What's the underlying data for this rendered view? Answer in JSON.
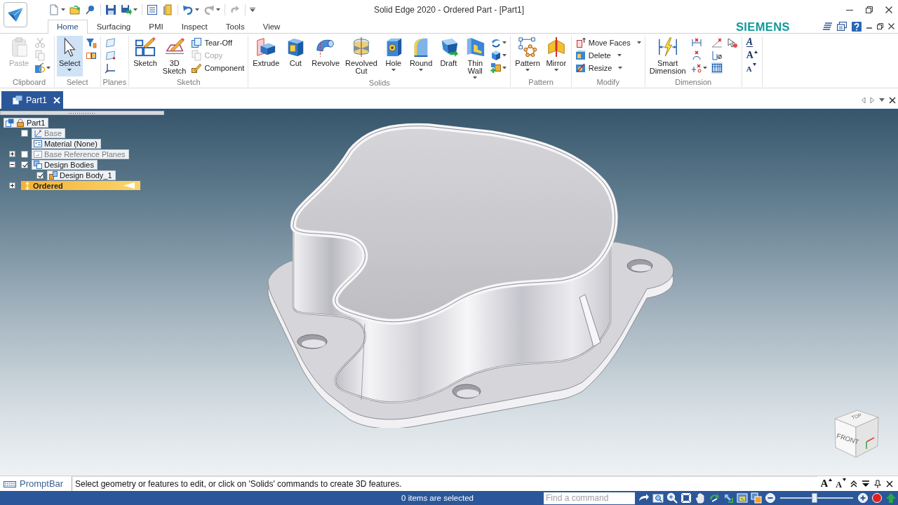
{
  "window": {
    "title": "Solid Edge 2020 - Ordered Part - [Part1]"
  },
  "quick_access": [
    {
      "items": [
        {
          "dropdown": true,
          "disabled": false
        },
        {
          "dropdown": false,
          "disabled": false
        },
        {
          "dropdown": false,
          "disabled": false
        }
      ]
    },
    {
      "items": [
        {
          "dropdown": false,
          "disabled": false
        },
        {
          "dropdown": true,
          "disabled": false
        }
      ]
    },
    {
      "items": [
        {
          "dropdown": false,
          "disabled": false
        },
        {
          "dropdown": false,
          "disabled": false
        }
      ]
    },
    {
      "items": [
        {
          "dropdown": true,
          "disabled": false
        },
        {
          "dropdown": true,
          "disabled": true
        }
      ]
    },
    {
      "items": [
        {
          "dropdown": false,
          "disabled": true
        }
      ]
    }
  ],
  "tabs": [
    {
      "label": "Home",
      "selected": true
    },
    {
      "label": "Surfacing",
      "selected": false
    },
    {
      "label": "PMI",
      "selected": false
    },
    {
      "label": "Inspect",
      "selected": false
    },
    {
      "label": "Tools",
      "selected": false
    },
    {
      "label": "View",
      "selected": false
    }
  ],
  "brand": "SIEMENS",
  "ribbon": {
    "groups": [
      {
        "label": "Clipboard",
        "items": [
          {
            "kind": "large",
            "label": "Paste",
            "disabled": true,
            "active": false,
            "dropdown": false
          },
          {
            "kind": "icon",
            "disabled": true,
            "active": false,
            "dropdown": false
          },
          {
            "kind": "icon",
            "disabled": true,
            "active": false,
            "dropdown": false
          },
          {
            "kind": "icon",
            "disabled": false,
            "active": false,
            "dropdown": true
          }
        ]
      },
      {
        "label": "Select",
        "items": [
          {
            "kind": "large",
            "label": "Select",
            "disabled": false,
            "active": true,
            "dropdown": true
          },
          {
            "kind": "icon",
            "disabled": false,
            "active": false,
            "dropdown": false
          },
          {
            "kind": "icon",
            "disabled": false,
            "active": false,
            "dropdown": false
          }
        ]
      },
      {
        "label": "Planes",
        "items": [
          {
            "kind": "icon",
            "disabled": false,
            "active": false,
            "dropdown": false
          },
          {
            "kind": "icon",
            "disabled": false,
            "active": false,
            "dropdown": false
          },
          {
            "kind": "icon",
            "disabled": false,
            "active": false,
            "dropdown": false
          }
        ]
      },
      {
        "label": "Sketch",
        "items": [
          {
            "kind": "large",
            "label": "Sketch",
            "disabled": false,
            "active": false,
            "dropdown": false
          },
          {
            "kind": "large",
            "label": "3D Sketch",
            "disabled": false,
            "active": false,
            "dropdown": false
          },
          {
            "kind": "small",
            "label": "Tear-Off",
            "disabled": false,
            "active": false,
            "dropdown": false
          },
          {
            "kind": "small",
            "label": "Copy",
            "disabled": true,
            "active": false,
            "dropdown": false
          },
          {
            "kind": "small",
            "label": "Component",
            "disabled": false,
            "active": false,
            "dropdown": false
          }
        ]
      },
      {
        "label": "Solids",
        "items": [
          {
            "kind": "large",
            "label": "Extrude",
            "disabled": false,
            "active": false,
            "dropdown": false
          },
          {
            "kind": "large",
            "label": "Cut",
            "disabled": false,
            "active": false,
            "dropdown": false
          },
          {
            "kind": "large",
            "label": "Revolve",
            "disabled": false,
            "active": false,
            "dropdown": false
          },
          {
            "kind": "large",
            "label": "Revolved Cut",
            "disabled": false,
            "active": false,
            "dropdown": false
          },
          {
            "kind": "large",
            "label": "Hole",
            "disabled": false,
            "active": false,
            "dropdown": true
          },
          {
            "kind": "large",
            "label": "Round",
            "disabled": false,
            "active": false,
            "dropdown": true
          },
          {
            "kind": "large",
            "label": "Draft",
            "disabled": false,
            "active": false,
            "dropdown": false
          },
          {
            "kind": "large",
            "label": "Thin Wall",
            "disabled": false,
            "active": false,
            "dropdown": true
          },
          {
            "kind": "icon",
            "disabled": false,
            "active": false,
            "dropdown": true
          },
          {
            "kind": "icon",
            "disabled": false,
            "active": false,
            "dropdown": true
          },
          {
            "kind": "icon",
            "disabled": false,
            "active": false,
            "dropdown": true
          }
        ]
      },
      {
        "label": "Pattern",
        "items": [
          {
            "kind": "large",
            "label": "Pattern",
            "disabled": false,
            "active": false,
            "dropdown": true
          },
          {
            "kind": "large",
            "label": "Mirror",
            "disabled": false,
            "active": false,
            "dropdown": true
          }
        ]
      },
      {
        "label": "Modify",
        "items": [
          {
            "kind": "small",
            "label": "Move Faces",
            "disabled": false,
            "active": false,
            "dropdown": true
          },
          {
            "kind": "small",
            "label": "Delete",
            "disabled": false,
            "active": false,
            "dropdown": true
          },
          {
            "kind": "small",
            "label": "Resize",
            "disabled": false,
            "active": false,
            "dropdown": true
          }
        ]
      },
      {
        "label": "Dimension",
        "items": [
          {
            "kind": "large",
            "label": "Smart Dimension",
            "disabled": false,
            "active": false,
            "dropdown": false
          },
          {
            "kind": "icon",
            "disabled": false,
            "active": false,
            "dropdown": false
          },
          {
            "kind": "icon",
            "disabled": false,
            "active": false,
            "dropdown": false
          },
          {
            "kind": "icon",
            "disabled": false,
            "active": false,
            "dropdown": true
          },
          {
            "kind": "icon",
            "disabled": false,
            "active": false,
            "dropdown": false
          },
          {
            "kind": "icon",
            "disabled": false,
            "active": false,
            "dropdown": false
          },
          {
            "kind": "icon",
            "disabled": false,
            "active": true,
            "dropdown": false
          },
          {
            "kind": "icon",
            "disabled": false,
            "active": false,
            "dropdown": false
          }
        ]
      },
      {
        "items": [
          {
            "kind": "style",
            "label": "A",
            "disabled": false,
            "active": false,
            "dropdown": false
          },
          {
            "kind": "grow",
            "label": "A",
            "disabled": false,
            "active": false,
            "dropdown": false
          },
          {
            "kind": "shrink",
            "label": "A",
            "disabled": false,
            "active": false,
            "dropdown": false
          }
        ]
      }
    ]
  },
  "document_tabs": [
    {
      "label": "Part1",
      "selected": true
    }
  ],
  "pathfinder": {
    "items": [
      {
        "kind": "root",
        "label": "Part1",
        "dimmed": false,
        "children": [
          {
            "kind": "toggle",
            "label": "Base",
            "checked": false,
            "dimmed": true
          },
          {
            "kind": "plain",
            "label": "Material (None)",
            "dimmed": false
          },
          {
            "kind": "toggle",
            "label": "Base Reference Planes",
            "checked": false,
            "dimmed": true,
            "expanded": false
          },
          {
            "kind": "toggle",
            "label": "Design Bodies",
            "checked": true,
            "dimmed": false,
            "expanded": true,
            "children": [
              {
                "kind": "toggle",
                "label": "Design Body_1",
                "checked": true,
                "dimmed": false
              }
            ]
          },
          {
            "kind": "marker",
            "label": "Ordered",
            "dimmed": false,
            "expanded": false
          }
        ]
      }
    ]
  },
  "view_cube": {
    "top": "TOP",
    "front": "FRONT"
  },
  "prompt_bar": {
    "label": "PromptBar",
    "message": "Select geometry or features to edit, or click on 'Solids' commands to create 3D features.",
    "font_buttons": [
      {
        "kind": "grow",
        "label": "A"
      },
      {
        "kind": "shrink",
        "label": "A"
      }
    ]
  },
  "status_bar": {
    "selection": "0 items are selected",
    "command_search": {
      "placeholder": "Find a command"
    },
    "zoom": {
      "level": 0.47
    }
  }
}
